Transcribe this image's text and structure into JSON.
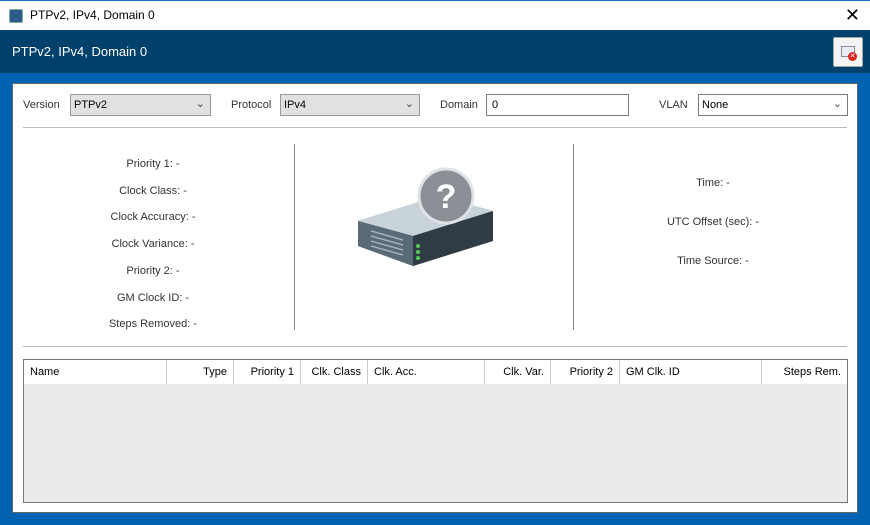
{
  "window": {
    "title": "PTPv2, IPv4, Domain 0",
    "close_icon": "close-icon"
  },
  "header": {
    "title": "PTPv2, IPv4, Domain 0",
    "close_view_icon": "window-close-red-icon"
  },
  "colors": {
    "border": "#0063b1",
    "header_band": "#00416b",
    "table_bg": "#ebebeb"
  },
  "filters": {
    "version": {
      "label": "Version",
      "value": "PTPv2"
    },
    "protocol": {
      "label": "Protocol",
      "value": "IPv4"
    },
    "domain": {
      "label": "Domain",
      "value": "0"
    },
    "vlan": {
      "label": "VLAN",
      "value": "None"
    }
  },
  "clock_info": [
    "Priority 1: -",
    "Clock Class: -",
    "Clock Accuracy: -",
    "Clock Variance: -",
    "Priority 2: -",
    "GM Clock ID: -",
    "Steps Removed: -"
  ],
  "center_icon": "server-unknown-icon",
  "time_info": [
    "Time: -",
    "UTC Offset (sec): -",
    "Time Source: -"
  ],
  "table": {
    "columns": [
      "Name",
      "Type",
      "Priority 1",
      "Clk. Class",
      "Clk. Acc.",
      "Clk. Var.",
      "Priority 2",
      "GM Clk. ID",
      "Steps Rem."
    ],
    "rows": []
  }
}
